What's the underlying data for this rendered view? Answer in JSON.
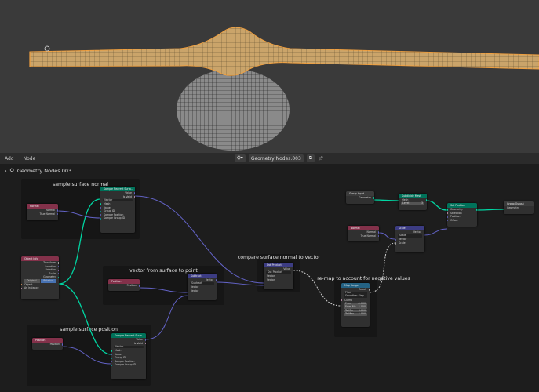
{
  "menu": {
    "add": "Add",
    "node": "Node"
  },
  "header": {
    "tree_name": "Geometry Nodes.003"
  },
  "breadcrumb": {
    "label": "Geometry Nodes.003"
  },
  "frames": {
    "f1": "sample surface normal",
    "f2": "vector from surface to point",
    "f3": "compare surface normal to vector",
    "f4": "re-map to account for negative values",
    "f5": "sample surface position"
  },
  "nodes": {
    "normal1": {
      "title": "Normal",
      "out1": "Normal",
      "out2": "True Normal"
    },
    "obinfo": {
      "title": "Object Info",
      "o1": "Transform",
      "o2": "Location",
      "o3": "Rotation",
      "o4": "Scale",
      "o5": "Geometry",
      "b1": "Original",
      "b2": "Relative",
      "i1": "Object",
      "i2": "As Instance"
    },
    "snsn": {
      "title": "Sample Nearest Surfa...",
      "o1": "Value",
      "o2": "Is Valid",
      "dd": "Vector",
      "i1": "Mesh",
      "i2": "Value",
      "i3": "Group ID",
      "i4": "Sample Position",
      "i5": "Sample Group ID"
    },
    "pos1": {
      "title": "Position",
      "out": "Position"
    },
    "subtract": {
      "title": "Subtract",
      "out": "Vector",
      "dd": "Subtract",
      "i1": "Vector",
      "i2": "Vector"
    },
    "dot": {
      "title": "Dot Product",
      "out": "Value",
      "dd": "Dot Product",
      "i1": "Vector",
      "i2": "Vector"
    },
    "pos2": {
      "title": "Position",
      "out": "Position"
    },
    "snsp": {
      "title": "Sample Nearest Surfa...",
      "o1": "Value",
      "o2": "Is Valid",
      "dd": "Vector",
      "i1": "Mesh",
      "i2": "Value",
      "i3": "Group ID",
      "i4": "Sample Position",
      "i5": "Sample Group ID"
    },
    "maprange": {
      "title": "Map Range",
      "out": "Result",
      "dd1": "Float",
      "dd2": "Smoother Step",
      "clamp": "Clamp",
      "f1l": "From",
      "f1v": "-1.000",
      "f2l": "From Ma",
      "f2v": "1.000",
      "f3l": "To Min",
      "f3v": "0.000",
      "f4l": "To Max",
      "f4v": "1.000"
    },
    "gin": {
      "title": "Group Input",
      "out": "Geometry"
    },
    "subdiv": {
      "title": "Subdivide Mesh",
      "out": "Mesh",
      "i1": "Mesh",
      "lvl_l": "Level",
      "lvl_v": "3"
    },
    "setpos": {
      "title": "Set Position",
      "out": "Geometry",
      "i1": "Geometry",
      "i2": "Selection",
      "i3": "Position",
      "i4": "Offset"
    },
    "gout": {
      "title": "Group Output",
      "i1": "Geometry"
    },
    "normal2": {
      "title": "Normal",
      "out1": "Normal",
      "out2": "True Normal"
    },
    "scale": {
      "title": "Scale",
      "out": "Vector",
      "dd": "Scale",
      "i1": "Vector",
      "i2": "Scale"
    }
  },
  "colors": {
    "geometry": "#00d6a3",
    "vector": "#6363c7",
    "float": "#a1a1a1",
    "attr_header": "#83314a",
    "vec_header": "#3c3c83",
    "geo_header": "#00725a",
    "util_header": "#246283",
    "orange": "#f0a040"
  }
}
